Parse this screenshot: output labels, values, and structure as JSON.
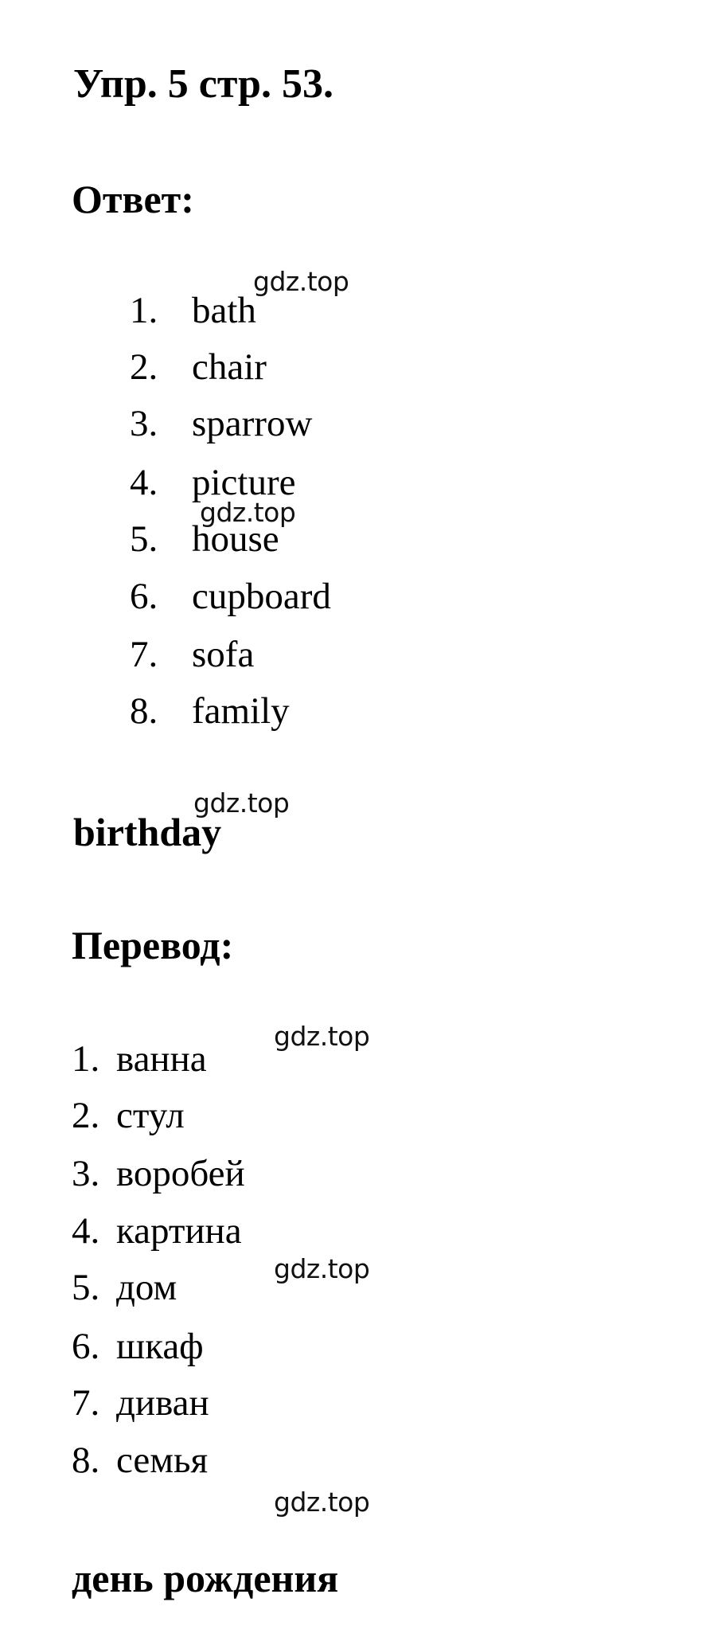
{
  "title": "Упр. 5 стр. 53.",
  "answer_heading": "Ответ:",
  "answers": [
    {
      "num": "1.",
      "word": "bath"
    },
    {
      "num": "2.",
      "word": "chair"
    },
    {
      "num": "3.",
      "word": "sparrow"
    },
    {
      "num": "4.",
      "word": "picture"
    },
    {
      "num": "5.",
      "word": "house"
    },
    {
      "num": "6.",
      "word": "cupboard"
    },
    {
      "num": "7.",
      "word": "sofa"
    },
    {
      "num": "8.",
      "word": "family"
    }
  ],
  "answer_keyword": "birthday",
  "translation_heading": "Перевод:",
  "translations": [
    {
      "num": "1.",
      "word": "ванна"
    },
    {
      "num": "2.",
      "word": "стул"
    },
    {
      "num": "3.",
      "word": "воробей"
    },
    {
      "num": "4.",
      "word": "картина"
    },
    {
      "num": "5.",
      "word": "дом"
    },
    {
      "num": "6.",
      "word": "шкаф"
    },
    {
      "num": "7.",
      "word": "диван"
    },
    {
      "num": "8.",
      "word": "семья"
    }
  ],
  "translation_keyword": "день рождения",
  "watermark": "gdz.top"
}
